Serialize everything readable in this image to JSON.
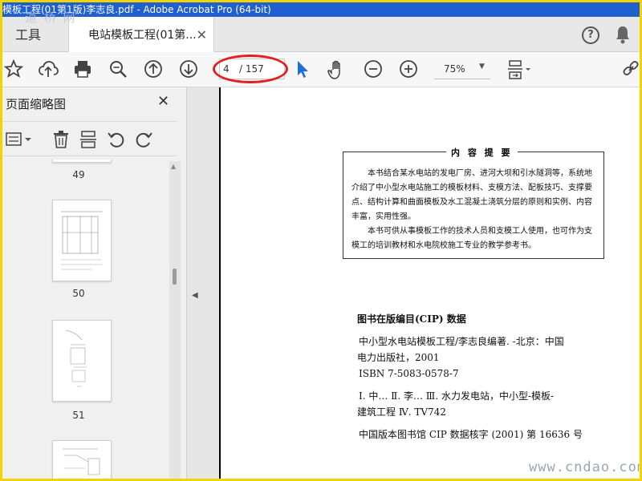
{
  "window": {
    "title": "模板工程(01第1版)李志良.pdf - Adobe Acrobat Pro (64-bit)"
  },
  "watermark_top": "道 桥 网",
  "watermark_bottom": "www.cndao.com",
  "tabs": {
    "tools_label": "工具",
    "document_label": "电站模板工程(01第...",
    "close_glyph": "✕"
  },
  "toolbar": {
    "page_current": "4",
    "page_total": "/ 157",
    "zoom": "75%",
    "highlight_color": "#e02020"
  },
  "sidebar": {
    "title": "页面缩略图",
    "close_glyph": "✕",
    "thumbnails": [
      {
        "label": "49"
      },
      {
        "label": "50"
      },
      {
        "label": "51"
      }
    ]
  },
  "document": {
    "summary_title": "内 容 提 要",
    "summary_para_1": "本书结合某水电站的发电厂房、进河大坝和引水隧洞等，系统地介绍了中小型水电站施工的模板材料、支模方法、配板技巧、支撑要点、结构计算和曲面模板及水工混凝土浇筑分层的原则和实例、内容丰富，实用性强。",
    "summary_para_2": "本书可供从事模板工作的技术人员和支模工人使用，也可作为支模工的培训教材和水电院校施工专业的教学参考书。",
    "cip_title": "图书在版编目(CIP) 数据",
    "cip_lines": [
      "中小型水电站模板工程/李志良编著. -北京：中国",
      "电力出版社，2001",
      "ISBN 7-5083-0578-7",
      "Ⅰ. 中…  Ⅱ. 李…  Ⅲ. 水力发电站，中小型-模板-",
      "建筑工程  Ⅳ. TV742",
      "中国版本图书馆 CIP 数据核字 (2001) 第 16636 号"
    ]
  }
}
